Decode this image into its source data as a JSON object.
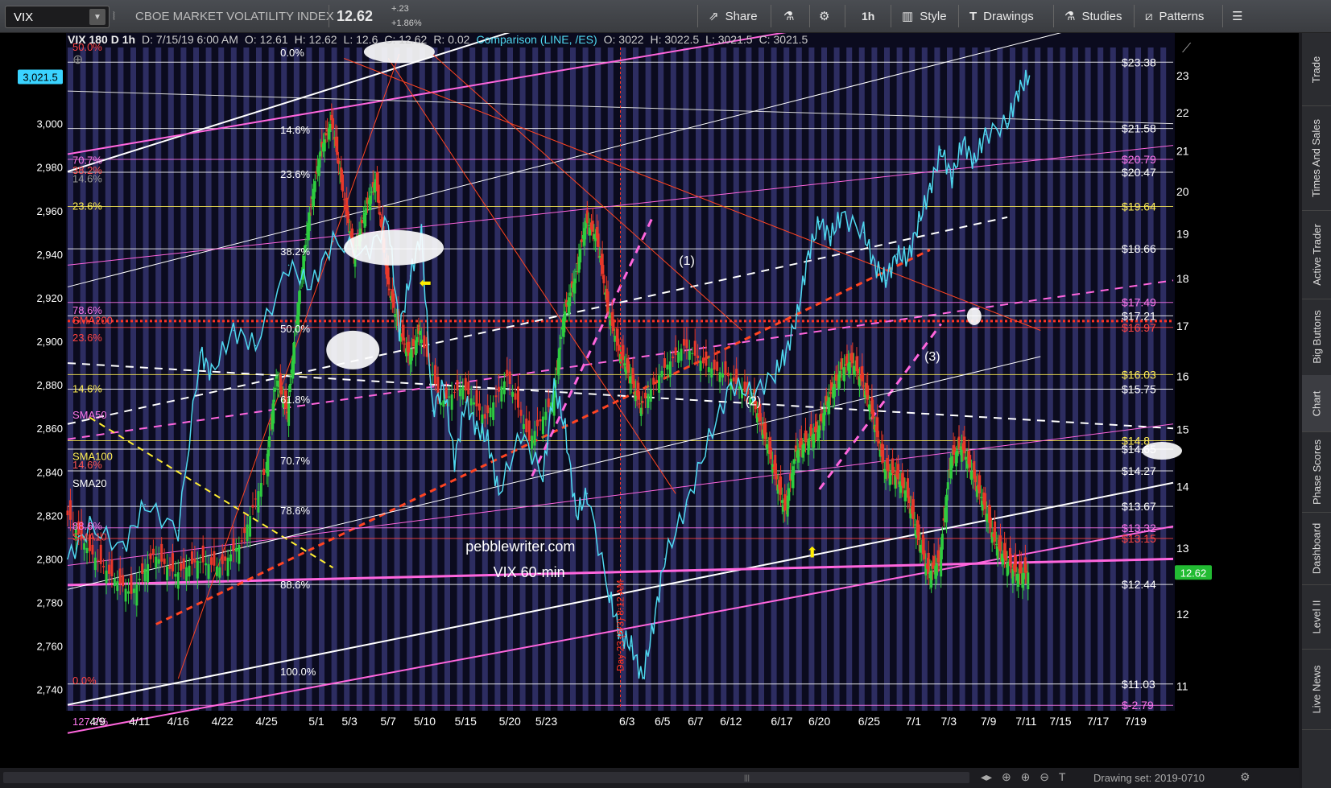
{
  "toolbar": {
    "symbol": "VIX",
    "description": "CBOE MARKET VOLATILITY INDEX",
    "last": "12.62",
    "change": "+.23",
    "change_pct": "+1.86%",
    "share": "Share",
    "interval": "1h",
    "style": "Style",
    "drawings": "Drawings",
    "studies": "Studies",
    "patterns": "Patterns"
  },
  "header": {
    "title": "VIX 180 D 1h",
    "date": "D: 7/15/19 6:00 AM",
    "open": "O: 12.61",
    "high": "H: 12.62",
    "low": "L: 12.6",
    "close": "C: 12.62",
    "range": "R: 0.02",
    "comparison": "Comparison (LINE, /ES)",
    "cmp_open": "O: 3022",
    "cmp_high": "H: 3022.5",
    "cmp_low": "L: 3021.5",
    "cmp_close": "C: 3021.5"
  },
  "dock": [
    "Trade",
    "Times And Sales",
    "Active Trader",
    "Big Buttons",
    "Chart",
    "Phase Scores",
    "Dashboard",
    "Level II",
    "Live News"
  ],
  "bottom": {
    "drawing_set": "Drawing set: 2019-0710"
  },
  "colors": {
    "vix_up": "#2ecc40",
    "vix_down": "#e8382a",
    "es_line": "#4fd8f0",
    "magenta": "#ff66dd",
    "bg": "#0b0b1e",
    "stripe": "#3a3a78"
  },
  "chart_data": {
    "type": "line",
    "x_ticks": [
      "4/9",
      "4/11",
      "4/16",
      "4/22",
      "4/25",
      "5/1",
      "5/3",
      "5/7",
      "5/10",
      "5/15",
      "5/20",
      "5/23",
      "6/3",
      "6/5",
      "6/7",
      "6/12",
      "6/17",
      "6/20",
      "6/25",
      "7/1",
      "7/3",
      "7/9",
      "7/11",
      "7/15",
      "7/17",
      "7/19"
    ],
    "left_axis": {
      "ticks": [
        "2,740",
        "2,760",
        "2,780",
        "2,800",
        "2,820",
        "2,840",
        "2,860",
        "2,880",
        "2,900",
        "2,920",
        "2,940",
        "2,960",
        "2,980",
        "3,000",
        "3,021.5"
      ],
      "range": [
        2731,
        3035
      ]
    },
    "right_axis": {
      "ticks": [
        "11",
        "12",
        "13",
        "14",
        "15",
        "16",
        "17",
        "18",
        "19",
        "20",
        "21",
        "22",
        "23"
      ],
      "range": [
        10.7,
        23.8
      ],
      "scale": "log"
    },
    "last_es_label": "3,021.5",
    "last_vix_label": "12.62",
    "fib_labels": [
      {
        "t": "0.0%",
        "y": 3032.5,
        "c": "#ffffff",
        "x": 0.105
      },
      {
        "t": "14.6%",
        "y": 2997,
        "c": "#ffffff",
        "x": 0.105
      },
      {
        "t": "23.6%",
        "y": 2976.5,
        "c": "#ffffff",
        "x": 0.105
      },
      {
        "t": "38.2%",
        "y": 2941,
        "c": "#ffffff",
        "x": 0.105
      },
      {
        "t": "50.0%",
        "y": 2905.5,
        "c": "#ffffff",
        "x": 0.105
      },
      {
        "t": "61.8%",
        "y": 2873,
        "c": "#ffffff",
        "x": 0.105
      },
      {
        "t": "70.7%",
        "y": 2845,
        "c": "#ffffff",
        "x": 0.105
      },
      {
        "t": "78.6%",
        "y": 2822,
        "c": "#ffffff",
        "x": 0.105
      },
      {
        "t": "88.6%",
        "y": 2788,
        "c": "#ffffff",
        "x": 0.105
      },
      {
        "t": "100.0%",
        "y": 2748,
        "c": "#ffffff",
        "x": 0.105
      },
      {
        "t": "70.7%",
        "y": 2983,
        "c": "#ff77ee",
        "x": 0.0
      },
      {
        "t": "38.2%",
        "y": 2978.5,
        "c": "#ff5555",
        "x": 0.0
      },
      {
        "t": "14.6%",
        "y": 2974.5,
        "c": "#999999",
        "x": 0.0
      },
      {
        "t": "23.6%",
        "y": 2962,
        "c": "#ffee55",
        "x": 0.0
      },
      {
        "t": "78.6%",
        "y": 2914,
        "c": "#ff77ee",
        "x": 0.0
      },
      {
        "t": "SMA200",
        "y": 2909.5,
        "c": "#ff4444",
        "x": 0.0
      },
      {
        "t": "23.6%",
        "y": 2901.5,
        "c": "#ff4444",
        "x": 0.0
      },
      {
        "t": "14.6%",
        "y": 2878,
        "c": "#ffee55",
        "x": 0.0
      },
      {
        "t": "SMA50",
        "y": 2866,
        "c": "#ff77ee",
        "x": 0.0
      },
      {
        "t": "SMA100",
        "y": 2847,
        "c": "#ffee55",
        "x": 0.0
      },
      {
        "t": "14.6%",
        "y": 2843,
        "c": "#ff5555",
        "x": 0.0
      },
      {
        "t": "SMA20",
        "y": 2834.5,
        "c": "#ffffff",
        "x": 0.0
      },
      {
        "t": "88.6%",
        "y": 2815,
        "c": "#ff77ee",
        "x": 0.0
      },
      {
        "t": "SMA10",
        "y": 2810,
        "c": "#ff4444",
        "x": 0.0
      },
      {
        "t": "0.0%",
        "y": 2744,
        "c": "#ff4444",
        "x": 0.0
      },
      {
        "t": "127.2%",
        "y": 2725,
        "c": "#ff77ee",
        "x": 0.0
      },
      {
        "t": "50.0%",
        "y": 3035,
        "c": "#ff4444",
        "x": 0.0
      }
    ],
    "price_labels": [
      {
        "t": "$23.38",
        "v": 23.38,
        "c": "#ffffff"
      },
      {
        "t": "$21.58",
        "v": 21.58,
        "c": "#ffffff"
      },
      {
        "t": "$20.79",
        "v": 20.79,
        "c": "#ff77ee"
      },
      {
        "t": "$20.47",
        "v": 20.47,
        "c": "#ffffff"
      },
      {
        "t": "$19.64",
        "v": 19.64,
        "c": "#ffee55"
      },
      {
        "t": "$18.66",
        "v": 18.66,
        "c": "#ffffff"
      },
      {
        "t": "$17.49",
        "v": 17.49,
        "c": "#ff77ee"
      },
      {
        "t": "$17.21",
        "v": 17.21,
        "c": "#ffffff"
      },
      {
        "t": "$16.97",
        "v": 16.97,
        "c": "#ff4444"
      },
      {
        "t": "$16.03",
        "v": 16.03,
        "c": "#ffee55"
      },
      {
        "t": "$15.75",
        "v": 15.75,
        "c": "#ffffff"
      },
      {
        "t": "$14.8",
        "v": 14.8,
        "c": "#ffee55"
      },
      {
        "t": "$14.65",
        "v": 14.65,
        "c": "#ffffff"
      },
      {
        "t": "$14.27",
        "v": 14.27,
        "c": "#ffffff"
      },
      {
        "t": "$13.67",
        "v": 13.67,
        "c": "#ffffff"
      },
      {
        "t": "$13.32",
        "v": 13.32,
        "c": "#ff77ee"
      },
      {
        "t": "$13.15",
        "v": 13.15,
        "c": "#ff4444"
      },
      {
        "t": "$12.44",
        "v": 12.44,
        "c": "#ffffff"
      },
      {
        "t": "$11.03",
        "v": 11.03,
        "c": "#ffffff"
      },
      {
        "t": "$-2.79",
        "v": 10.75,
        "c": "#ff77ee"
      }
    ],
    "annotations": [
      {
        "t": "(1)",
        "x": 0.553,
        "v": 18.3
      },
      {
        "t": "(2)",
        "x": 0.613,
        "v": 15.45
      },
      {
        "t": "(3)",
        "x": 0.775,
        "v": 16.3
      },
      {
        "t": "pebblewriter.com",
        "x": 0.36,
        "v": 12.95
      },
      {
        "t": "VIX 60-min",
        "x": 0.385,
        "v": 12.55
      }
    ],
    "vertical_annotation": "Day 23 (6/3) 8:12 AM",
    "es_series": [
      [
        0,
        2800
      ],
      [
        0.02,
        2815
      ],
      [
        0.05,
        2805
      ],
      [
        0.07,
        2825
      ],
      [
        0.1,
        2813
      ],
      [
        0.12,
        2895
      ],
      [
        0.13,
        2885
      ],
      [
        0.15,
        2905
      ],
      [
        0.17,
        2898
      ],
      [
        0.2,
        2935
      ],
      [
        0.22,
        2925
      ],
      [
        0.24,
        2946
      ],
      [
        0.27,
        2940
      ],
      [
        0.29,
        2955
      ],
      [
        0.3,
        2905
      ],
      [
        0.31,
        2930
      ],
      [
        0.32,
        2950
      ],
      [
        0.33,
        2868
      ],
      [
        0.34,
        2880
      ],
      [
        0.35,
        2845
      ],
      [
        0.36,
        2872
      ],
      [
        0.37,
        2860
      ],
      [
        0.38,
        2855
      ],
      [
        0.39,
        2830
      ],
      [
        0.41,
        2858
      ],
      [
        0.43,
        2838
      ],
      [
        0.44,
        2880
      ],
      [
        0.45,
        2860
      ],
      [
        0.46,
        2820
      ],
      [
        0.47,
        2830
      ],
      [
        0.49,
        2783
      ],
      [
        0.5,
        2765
      ],
      [
        0.51,
        2760
      ],
      [
        0.52,
        2745
      ],
      [
        0.53,
        2770
      ],
      [
        0.54,
        2800
      ],
      [
        0.56,
        2825
      ],
      [
        0.58,
        2855
      ],
      [
        0.6,
        2880
      ],
      [
        0.62,
        2876
      ],
      [
        0.64,
        2885
      ],
      [
        0.65,
        2895
      ],
      [
        0.66,
        2912
      ],
      [
        0.67,
        2940
      ],
      [
        0.68,
        2955
      ],
      [
        0.69,
        2948
      ],
      [
        0.7,
        2958
      ],
      [
        0.72,
        2950
      ],
      [
        0.73,
        2935
      ],
      [
        0.74,
        2928
      ],
      [
        0.75,
        2940
      ],
      [
        0.76,
        2938
      ],
      [
        0.77,
        2955
      ],
      [
        0.78,
        2970
      ],
      [
        0.79,
        2988
      ],
      [
        0.8,
        2975
      ],
      [
        0.81,
        2992
      ],
      [
        0.82,
        2982
      ],
      [
        0.83,
        2995
      ],
      [
        0.85,
        3000
      ],
      [
        0.86,
        3015
      ],
      [
        0.87,
        3022
      ]
    ],
    "vix_series": [
      [
        0,
        13.6
      ],
      [
        0.02,
        13.0
      ],
      [
        0.04,
        12.6
      ],
      [
        0.06,
        12.3
      ],
      [
        0.08,
        12.9
      ],
      [
        0.1,
        12.6
      ],
      [
        0.12,
        12.8
      ],
      [
        0.14,
        12.7
      ],
      [
        0.16,
        13.1
      ],
      [
        0.18,
        14.2
      ],
      [
        0.19,
        16.0
      ],
      [
        0.2,
        15.3
      ],
      [
        0.21,
        17.5
      ],
      [
        0.22,
        19.5
      ],
      [
        0.23,
        21.0
      ],
      [
        0.24,
        21.8
      ],
      [
        0.25,
        20.0
      ],
      [
        0.26,
        18.5
      ],
      [
        0.27,
        19.5
      ],
      [
        0.28,
        20.3
      ],
      [
        0.29,
        18.0
      ],
      [
        0.3,
        17.0
      ],
      [
        0.31,
        16.4
      ],
      [
        0.32,
        16.9
      ],
      [
        0.34,
        15.5
      ],
      [
        0.36,
        15.8
      ],
      [
        0.38,
        15.2
      ],
      [
        0.4,
        16.0
      ],
      [
        0.42,
        14.8
      ],
      [
        0.44,
        15.5
      ],
      [
        0.45,
        17.2
      ],
      [
        0.46,
        18.0
      ],
      [
        0.47,
        19.3
      ],
      [
        0.48,
        18.9
      ],
      [
        0.49,
        17.3
      ],
      [
        0.5,
        16.5
      ],
      [
        0.51,
        16.0
      ],
      [
        0.52,
        15.4
      ],
      [
        0.54,
        16.1
      ],
      [
        0.56,
        16.6
      ],
      [
        0.58,
        16.2
      ],
      [
        0.6,
        16.0
      ],
      [
        0.62,
        15.6
      ],
      [
        0.63,
        15.0
      ],
      [
        0.64,
        14.3
      ],
      [
        0.65,
        13.6
      ],
      [
        0.66,
        14.6
      ],
      [
        0.67,
        14.8
      ],
      [
        0.68,
        15.0
      ],
      [
        0.69,
        15.6
      ],
      [
        0.7,
        16.1
      ],
      [
        0.71,
        16.3
      ],
      [
        0.72,
        15.9
      ],
      [
        0.73,
        15.2
      ],
      [
        0.74,
        14.3
      ],
      [
        0.75,
        14.2
      ],
      [
        0.76,
        13.9
      ],
      [
        0.77,
        13.2
      ],
      [
        0.78,
        12.6
      ],
      [
        0.79,
        12.8
      ],
      [
        0.8,
        14.5
      ],
      [
        0.81,
        14.7
      ],
      [
        0.82,
        14.2
      ],
      [
        0.83,
        13.7
      ],
      [
        0.84,
        13.1
      ],
      [
        0.85,
        12.8
      ],
      [
        0.86,
        12.6
      ],
      [
        0.87,
        12.62
      ]
    ]
  }
}
